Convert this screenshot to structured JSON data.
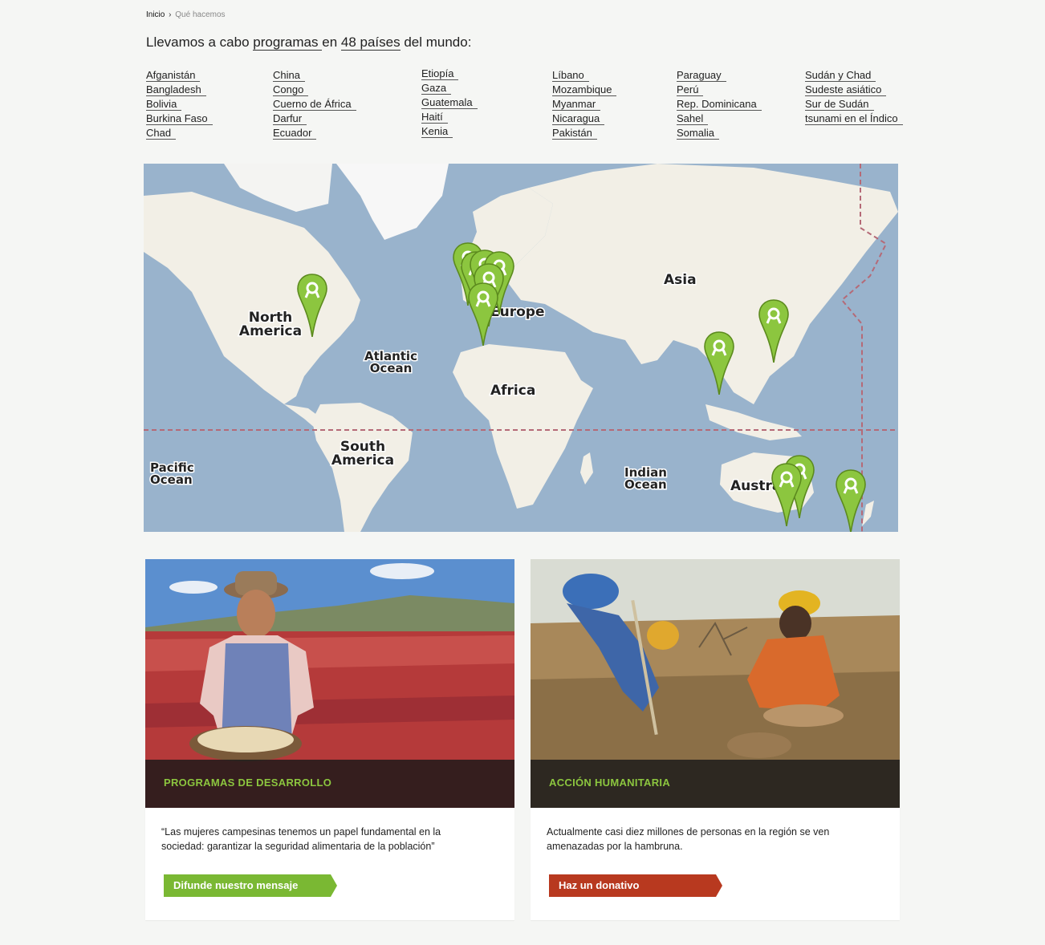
{
  "breadcrumb": {
    "home": "Inicio",
    "separator": "›",
    "current": "Qué hacemos"
  },
  "headline": {
    "before": "Llevamos a cabo ",
    "link1": "programas ",
    "middle": "en ",
    "link2": "48 países",
    "after": " del mundo:"
  },
  "countries": [
    [
      "Afganistán",
      "Bangladesh",
      "Bolivia",
      "Burkina Faso",
      "Chad"
    ],
    [
      "China",
      "Congo",
      "Cuerno de África",
      "Darfur",
      "Ecuador"
    ],
    [
      "Etiopía",
      "Gaza",
      "Guatemala",
      "Haití",
      "Kenia"
    ],
    [
      "Líbano",
      "Mozambique",
      "Myanmar",
      "Nicaragua",
      "Pakistán"
    ],
    [
      "Paraguay",
      "Perú",
      "Rep. Dominicana",
      "Sahel",
      "Somalia"
    ],
    [
      "Sudán y Chad",
      "Sudeste asiático",
      "Sur de Sudán",
      "tsunami en el Índico"
    ]
  ],
  "map": {
    "labels": {
      "north_america": [
        "North",
        "America"
      ],
      "atlantic": [
        "Atlantic",
        "Ocean"
      ],
      "south_america": [
        "South",
        "America"
      ],
      "pacific": [
        "Pacific",
        "Ocean"
      ],
      "europe": "Europe",
      "africa": "Africa",
      "asia": "Asia",
      "indian": [
        "Indian",
        "Ocean"
      ],
      "australia": "Austra"
    },
    "marker_color": "#8cc63f",
    "marker_icon": "map-pin-icon"
  },
  "cards": [
    {
      "band_title": "PROGRAMAS DE DESARROLLO",
      "description": "“Las mujeres campesinas tenemos un papel fundamental en la sociedad: garantizar la seguridad alimentaria de la población”",
      "cta": "Difunde nuestro mensaje",
      "cta_color": "#7ab833"
    },
    {
      "band_title": "ACCIÓN HUMANITARIA",
      "description": "Actualmente casi diez millones de personas en la región se ven amenazadas por la hambruna.",
      "cta": "Haz un donativo",
      "cta_color": "#b8391f"
    }
  ],
  "colors": {
    "accent_green": "#8cc63f",
    "background": "#f5f6f4",
    "ocean": "#99b3cc",
    "land": "#f2efe6"
  }
}
